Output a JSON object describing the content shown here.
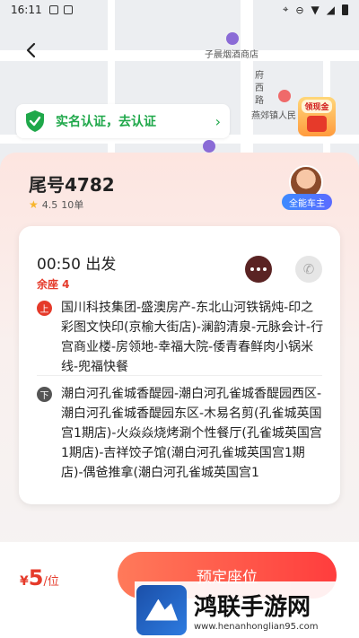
{
  "status_bar": {
    "time": "16:11"
  },
  "map": {
    "poi_1": "子晨烟酒商店",
    "road_name": "府西路",
    "poi_2": "燕郊镇人民",
    "cash_badge": "领现金"
  },
  "verify_banner": {
    "text": "实名认证，去认证",
    "arrow": "›"
  },
  "driver": {
    "plate": "尾号4782",
    "rating": "4.5",
    "orders": "10单",
    "badge": "全能车主"
  },
  "trip": {
    "depart_time": "00:50 出发",
    "seats_left": "余座 4",
    "pickup_tag": "上",
    "pickup_text": "国川科技集团-盛澳房产-东北山河铁锅炖-印之彩图文快印(京榆大街店)-澜韵清泉-元脉会计-行宫商业楼-房领地-幸福大院-倭青春鲜肉小锅米线-兜福快餐",
    "dropoff_tag": "下",
    "dropoff_text": "潮白河孔雀城香醍园-潮白河孔雀城香醍园西区-潮白河孔雀城香醍园东区-木易名剪(孔雀城英国宫1期店)-火焱焱烧烤涮个性餐厅(孔雀城英国宫1期店)-吉祥饺子馆(潮白河孔雀城英国宫1期店)-偶爸推拿(潮白河孔雀城英国宫1"
  },
  "bottom": {
    "currency": "¥",
    "price": "5",
    "unit": "/位",
    "book_label": "预定座位"
  },
  "watermark": {
    "title": "鸿联手游网",
    "url": "www.henanhonglian95.com"
  },
  "colors": {
    "accent_red": "#e53a2a",
    "verify_green": "#1fa84a",
    "chat_brown": "#5a2323"
  }
}
